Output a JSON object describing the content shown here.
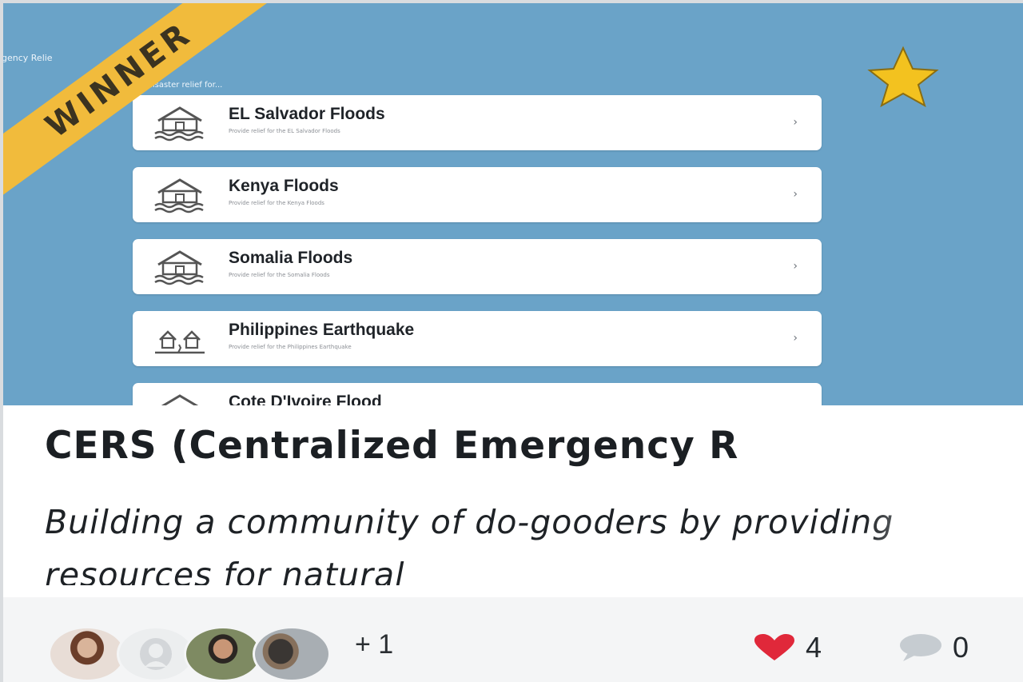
{
  "preview": {
    "app_title": "gency Relie",
    "app_subtitle": "ovide disaster relief for...",
    "items": [
      {
        "title": "EL Salvador Floods",
        "desc": "Provide relief for the EL Salvador Floods",
        "icon": "flood-house-icon"
      },
      {
        "title": "Kenya Floods",
        "desc": "Provide relief for the Kenya Floods",
        "icon": "flood-house-icon"
      },
      {
        "title": "Somalia Floods",
        "desc": "Provide relief for the Somalia Floods",
        "icon": "flood-house-icon"
      },
      {
        "title": "Philippines Earthquake",
        "desc": "Provide relief for the Philippines Earthquake",
        "icon": "earthquake-icon"
      },
      {
        "title": "Cote D'Ivoire Flood",
        "desc": "",
        "icon": "flood-house-icon"
      }
    ]
  },
  "ribbon": {
    "label": "WINNER"
  },
  "project": {
    "name": "CERS (Centralized Emergency R",
    "tagline": "Building a community of do-gooders by providing resources for natural"
  },
  "footer": {
    "more_members": "+ 1",
    "likes": "4",
    "comments": "0"
  },
  "colors": {
    "preview_bg": "#6aa3c8",
    "ribbon": "#f1bb3c",
    "heart": "#e0283a",
    "star": "#f3c21f"
  }
}
